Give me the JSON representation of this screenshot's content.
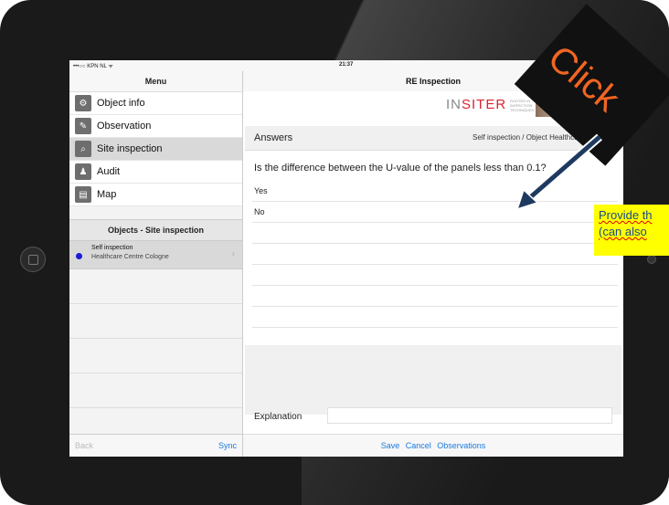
{
  "status": {
    "carrier": "•••○○ KPN NL ᯤ",
    "time": "21:37"
  },
  "menu": {
    "title": "Menu",
    "items": [
      {
        "label": "Object info",
        "icon": "object-info-icon",
        "active": false
      },
      {
        "label": "Observation",
        "icon": "pencil-icon",
        "active": false
      },
      {
        "label": "Site inspection",
        "icon": "magnifier-icon",
        "active": true
      },
      {
        "label": "Audit",
        "icon": "person-icon",
        "active": false
      },
      {
        "label": "Map",
        "icon": "map-icon",
        "active": false
      }
    ]
  },
  "objects": {
    "header": "Objects - Site inspection",
    "item": {
      "title": "Self inspection",
      "subtitle": "Healthcare Centre Cologne"
    }
  },
  "left_footer": {
    "back": "Back",
    "sync": "Sync"
  },
  "right": {
    "title": "RE Inspection",
    "logo": {
      "part1": "IN",
      "part2": "SITER",
      "tagline": "ROOTED IN INSPECTION TECHNIQUES"
    },
    "answers_label": "Answers",
    "answers_path": "Self inspection / Object Healthcare Centre C",
    "question": "Is the difference between the U-value of the panels less than 0.1?",
    "options": [
      "Yes",
      "No"
    ],
    "explanation_label": "Explanation",
    "explanation_value": "",
    "actions": {
      "save": "Save",
      "cancel": "Cancel",
      "observations": "Observations"
    }
  },
  "overlay": {
    "click_text": "Click",
    "note_line1": "Provide th",
    "note_line2": "(can also",
    "colors": {
      "click": "#f26522",
      "note_bg": "#ffff00",
      "arrow": "#1f3a5f"
    }
  }
}
